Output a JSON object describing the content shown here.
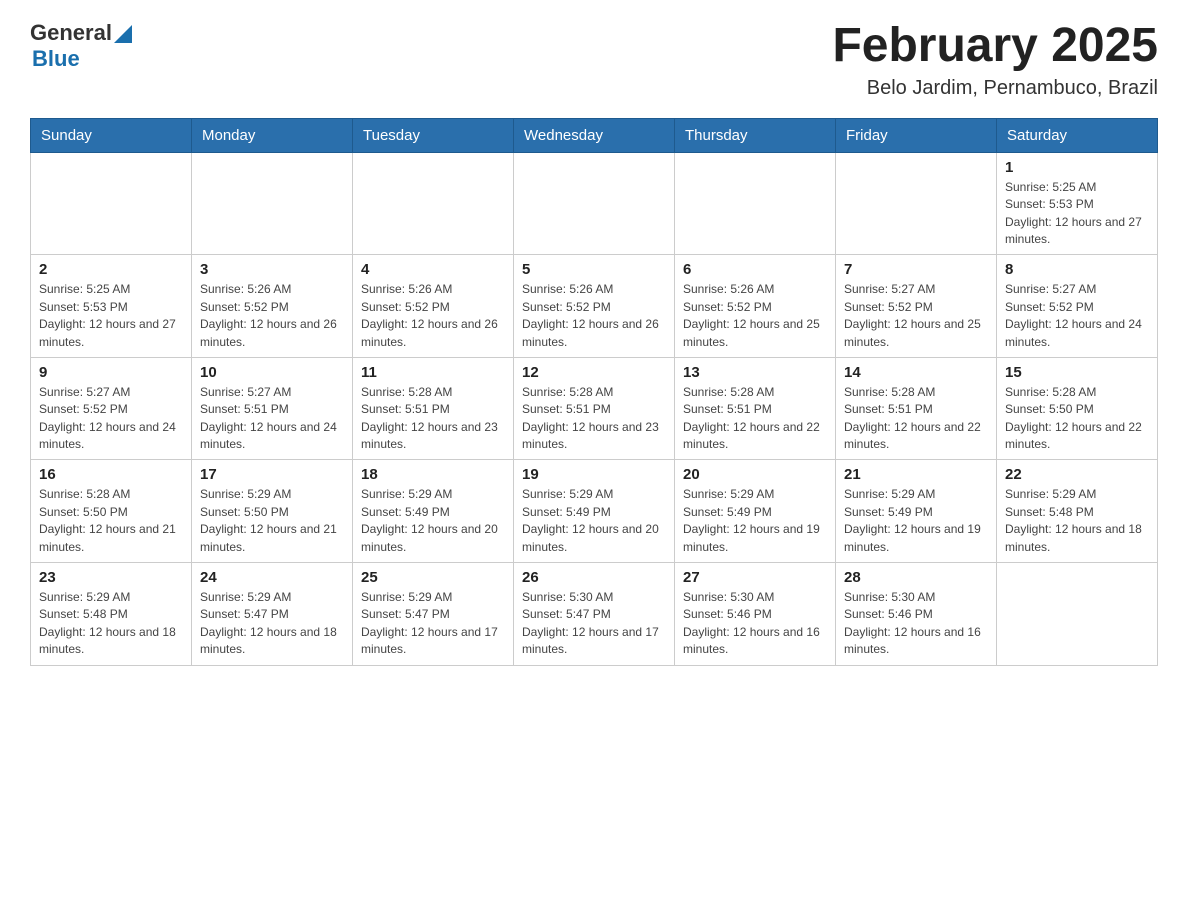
{
  "header": {
    "logo_general": "General",
    "logo_blue": "Blue",
    "title": "February 2025",
    "subtitle": "Belo Jardim, Pernambuco, Brazil"
  },
  "days_of_week": [
    "Sunday",
    "Monday",
    "Tuesday",
    "Wednesday",
    "Thursday",
    "Friday",
    "Saturday"
  ],
  "weeks": [
    [
      {
        "day": "",
        "sunrise": "",
        "sunset": "",
        "daylight": ""
      },
      {
        "day": "",
        "sunrise": "",
        "sunset": "",
        "daylight": ""
      },
      {
        "day": "",
        "sunrise": "",
        "sunset": "",
        "daylight": ""
      },
      {
        "day": "",
        "sunrise": "",
        "sunset": "",
        "daylight": ""
      },
      {
        "day": "",
        "sunrise": "",
        "sunset": "",
        "daylight": ""
      },
      {
        "day": "",
        "sunrise": "",
        "sunset": "",
        "daylight": ""
      },
      {
        "day": "1",
        "sunrise": "Sunrise: 5:25 AM",
        "sunset": "Sunset: 5:53 PM",
        "daylight": "Daylight: 12 hours and 27 minutes."
      }
    ],
    [
      {
        "day": "2",
        "sunrise": "Sunrise: 5:25 AM",
        "sunset": "Sunset: 5:53 PM",
        "daylight": "Daylight: 12 hours and 27 minutes."
      },
      {
        "day": "3",
        "sunrise": "Sunrise: 5:26 AM",
        "sunset": "Sunset: 5:52 PM",
        "daylight": "Daylight: 12 hours and 26 minutes."
      },
      {
        "day": "4",
        "sunrise": "Sunrise: 5:26 AM",
        "sunset": "Sunset: 5:52 PM",
        "daylight": "Daylight: 12 hours and 26 minutes."
      },
      {
        "day": "5",
        "sunrise": "Sunrise: 5:26 AM",
        "sunset": "Sunset: 5:52 PM",
        "daylight": "Daylight: 12 hours and 26 minutes."
      },
      {
        "day": "6",
        "sunrise": "Sunrise: 5:26 AM",
        "sunset": "Sunset: 5:52 PM",
        "daylight": "Daylight: 12 hours and 25 minutes."
      },
      {
        "day": "7",
        "sunrise": "Sunrise: 5:27 AM",
        "sunset": "Sunset: 5:52 PM",
        "daylight": "Daylight: 12 hours and 25 minutes."
      },
      {
        "day": "8",
        "sunrise": "Sunrise: 5:27 AM",
        "sunset": "Sunset: 5:52 PM",
        "daylight": "Daylight: 12 hours and 24 minutes."
      }
    ],
    [
      {
        "day": "9",
        "sunrise": "Sunrise: 5:27 AM",
        "sunset": "Sunset: 5:52 PM",
        "daylight": "Daylight: 12 hours and 24 minutes."
      },
      {
        "day": "10",
        "sunrise": "Sunrise: 5:27 AM",
        "sunset": "Sunset: 5:51 PM",
        "daylight": "Daylight: 12 hours and 24 minutes."
      },
      {
        "day": "11",
        "sunrise": "Sunrise: 5:28 AM",
        "sunset": "Sunset: 5:51 PM",
        "daylight": "Daylight: 12 hours and 23 minutes."
      },
      {
        "day": "12",
        "sunrise": "Sunrise: 5:28 AM",
        "sunset": "Sunset: 5:51 PM",
        "daylight": "Daylight: 12 hours and 23 minutes."
      },
      {
        "day": "13",
        "sunrise": "Sunrise: 5:28 AM",
        "sunset": "Sunset: 5:51 PM",
        "daylight": "Daylight: 12 hours and 22 minutes."
      },
      {
        "day": "14",
        "sunrise": "Sunrise: 5:28 AM",
        "sunset": "Sunset: 5:51 PM",
        "daylight": "Daylight: 12 hours and 22 minutes."
      },
      {
        "day": "15",
        "sunrise": "Sunrise: 5:28 AM",
        "sunset": "Sunset: 5:50 PM",
        "daylight": "Daylight: 12 hours and 22 minutes."
      }
    ],
    [
      {
        "day": "16",
        "sunrise": "Sunrise: 5:28 AM",
        "sunset": "Sunset: 5:50 PM",
        "daylight": "Daylight: 12 hours and 21 minutes."
      },
      {
        "day": "17",
        "sunrise": "Sunrise: 5:29 AM",
        "sunset": "Sunset: 5:50 PM",
        "daylight": "Daylight: 12 hours and 21 minutes."
      },
      {
        "day": "18",
        "sunrise": "Sunrise: 5:29 AM",
        "sunset": "Sunset: 5:49 PM",
        "daylight": "Daylight: 12 hours and 20 minutes."
      },
      {
        "day": "19",
        "sunrise": "Sunrise: 5:29 AM",
        "sunset": "Sunset: 5:49 PM",
        "daylight": "Daylight: 12 hours and 20 minutes."
      },
      {
        "day": "20",
        "sunrise": "Sunrise: 5:29 AM",
        "sunset": "Sunset: 5:49 PM",
        "daylight": "Daylight: 12 hours and 19 minutes."
      },
      {
        "day": "21",
        "sunrise": "Sunrise: 5:29 AM",
        "sunset": "Sunset: 5:49 PM",
        "daylight": "Daylight: 12 hours and 19 minutes."
      },
      {
        "day": "22",
        "sunrise": "Sunrise: 5:29 AM",
        "sunset": "Sunset: 5:48 PM",
        "daylight": "Daylight: 12 hours and 18 minutes."
      }
    ],
    [
      {
        "day": "23",
        "sunrise": "Sunrise: 5:29 AM",
        "sunset": "Sunset: 5:48 PM",
        "daylight": "Daylight: 12 hours and 18 minutes."
      },
      {
        "day": "24",
        "sunrise": "Sunrise: 5:29 AM",
        "sunset": "Sunset: 5:47 PM",
        "daylight": "Daylight: 12 hours and 18 minutes."
      },
      {
        "day": "25",
        "sunrise": "Sunrise: 5:29 AM",
        "sunset": "Sunset: 5:47 PM",
        "daylight": "Daylight: 12 hours and 17 minutes."
      },
      {
        "day": "26",
        "sunrise": "Sunrise: 5:30 AM",
        "sunset": "Sunset: 5:47 PM",
        "daylight": "Daylight: 12 hours and 17 minutes."
      },
      {
        "day": "27",
        "sunrise": "Sunrise: 5:30 AM",
        "sunset": "Sunset: 5:46 PM",
        "daylight": "Daylight: 12 hours and 16 minutes."
      },
      {
        "day": "28",
        "sunrise": "Sunrise: 5:30 AM",
        "sunset": "Sunset: 5:46 PM",
        "daylight": "Daylight: 12 hours and 16 minutes."
      },
      {
        "day": "",
        "sunrise": "",
        "sunset": "",
        "daylight": ""
      }
    ]
  ]
}
